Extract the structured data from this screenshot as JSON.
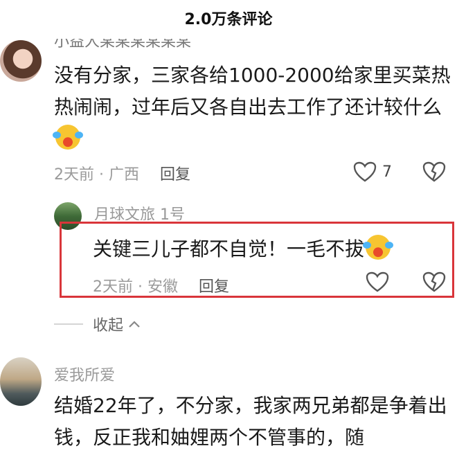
{
  "header": {
    "title": "2.0万条评论"
  },
  "comments": [
    {
      "username": "小益人某某某某某某",
      "text": "没有分家，三家各给1000-2000给家里买菜热热闹闹，过年后又各自出去工作了还计较什么",
      "emoji_icon": "laughing-crying-emoji",
      "time_location": "2天前 · 广西",
      "reply_label": "回复",
      "likes": "7"
    },
    {
      "username": "爱我所爱",
      "text": "结婚22年了，不分家，我家两兄弟都是争着出钱，反正我和妯娌两个不管事的，随"
    }
  ],
  "reply": {
    "username": "月球文旅 1号",
    "text": "关键三儿子都不自觉！一毛不拔",
    "emoji_icon": "laughing-crying-emoji",
    "time_location": "2天前 · 安徽",
    "reply_label": "回复"
  },
  "collapse": {
    "label": "收起"
  },
  "colors": {
    "highlight_border": "#d9353a",
    "meta_text": "#9a9a9a"
  }
}
